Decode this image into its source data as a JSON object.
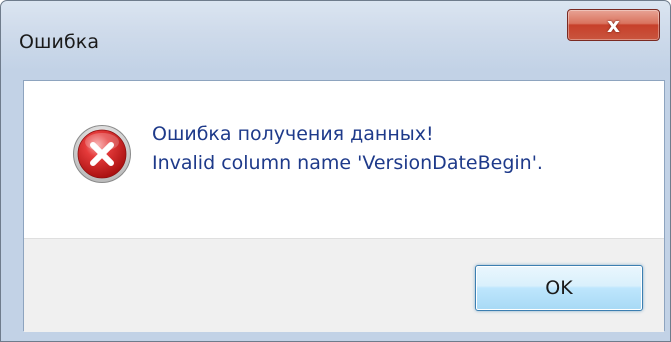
{
  "window": {
    "title": "Ошибка",
    "close_glyph": "x"
  },
  "dialog": {
    "icon": "error-icon",
    "message_line1": "Ошибка получения данных!",
    "message_line2": "Invalid column name 'VersionDateBegin'."
  },
  "buttons": {
    "ok_label": "OK"
  },
  "colors": {
    "message_text": "#1e3a8a",
    "error_icon_red": "#d81e1e",
    "close_button_red": "#c7402a"
  }
}
